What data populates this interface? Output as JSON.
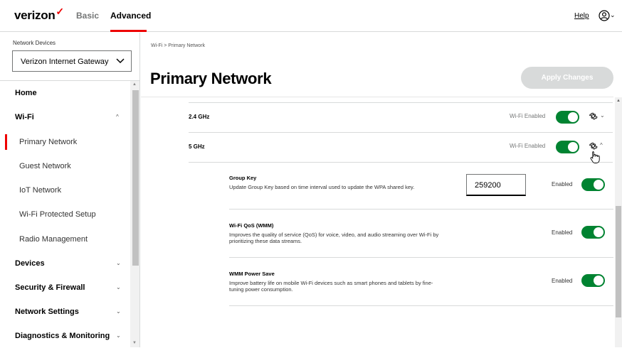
{
  "header": {
    "logo": "verizon",
    "tabs": [
      "Basic",
      "Advanced"
    ],
    "help": "Help"
  },
  "sidebar": {
    "devices_label": "Network Devices",
    "selected_device": "Verizon Internet Gateway",
    "items": [
      {
        "label": "Home",
        "type": "section"
      },
      {
        "label": "Wi-Fi",
        "type": "section",
        "chevron": "up"
      },
      {
        "label": "Primary Network",
        "type": "sub",
        "active": true
      },
      {
        "label": "Guest Network",
        "type": "sub"
      },
      {
        "label": "IoT Network",
        "type": "sub"
      },
      {
        "label": "Wi-Fi Protected Setup",
        "type": "sub"
      },
      {
        "label": "Radio Management",
        "type": "sub"
      },
      {
        "label": "Devices",
        "type": "section",
        "chevron": "down"
      },
      {
        "label": "Security & Firewall",
        "type": "section",
        "chevron": "down"
      },
      {
        "label": "Network Settings",
        "type": "section",
        "chevron": "down"
      },
      {
        "label": "Diagnostics & Monitoring",
        "type": "section",
        "chevron": "down"
      }
    ]
  },
  "main": {
    "breadcrumb": "Wi-Fi  >  Primary Network",
    "title": "Primary Network",
    "apply_button": "Apply Changes",
    "bands": [
      {
        "label": "2.4 GHz",
        "status": "Wi-Fi Enabled",
        "enabled": true,
        "expanded": false
      },
      {
        "label": "5 GHz",
        "status": "Wi-Fi Enabled",
        "enabled": true,
        "expanded": true
      }
    ],
    "settings": [
      {
        "title": "Group Key",
        "description": "Update Group Key based on time interval used to update the WPA shared key.",
        "value": "259200",
        "status": "Enabled",
        "enabled": true
      },
      {
        "title": "Wi-Fi QoS (WMM)",
        "description": "Improves the quality of service (QoS) for voice, video, and audio streaming over Wi-Fi by prioritizing these data streams.",
        "status": "Enabled",
        "enabled": true
      },
      {
        "title": "WMM Power Save",
        "description": "Improve battery life on mobile Wi-Fi devices such as smart phones and tablets by fine-tuning power consumption.",
        "status": "Enabled",
        "enabled": true
      }
    ]
  },
  "colors": {
    "brand_red": "#ee0000",
    "toggle_green": "#008331",
    "disabled_button": "#d8dada"
  },
  "icons": [
    "user-icon",
    "chevron-down-icon",
    "chevron-up-icon",
    "gear-icon",
    "hand-pointer-icon"
  ]
}
